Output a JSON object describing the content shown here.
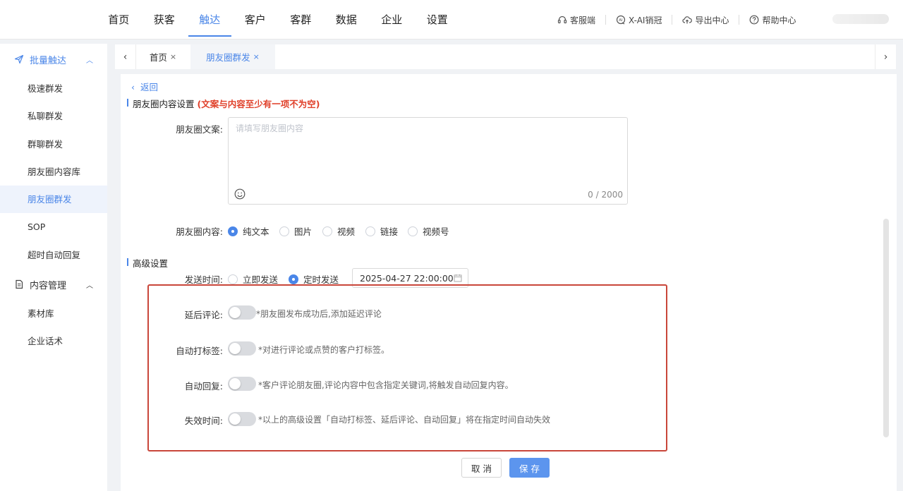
{
  "topnav": {
    "items": [
      "首页",
      "获客",
      "触达",
      "客户",
      "客群",
      "数据",
      "企业",
      "设置"
    ],
    "active_index": 2
  },
  "toptools": {
    "service": "客服端",
    "ai": "X-AI销冠",
    "export": "导出中心",
    "help": "帮助中心"
  },
  "sidebar": {
    "group1": "批量触达",
    "group1_items": [
      "极速群发",
      "私聊群发",
      "群聊群发",
      "朋友圈内容库",
      "朋友圈群发",
      "SOP",
      "超时自动回复"
    ],
    "group1_active_index": 4,
    "group2": "内容管理",
    "group2_items": [
      "素材库",
      "企业话术"
    ]
  },
  "tabs": {
    "tab1": "首页",
    "tab2": "朋友圈群发",
    "close": "×",
    "left_arrow": "‹",
    "right_arrow": "›"
  },
  "page": {
    "back": "返回",
    "section1_title": "朋友圈内容设置",
    "section1_warn": "(文案与内容至少有一项不为空)",
    "copy_label": "朋友圈文案:",
    "copy_placeholder": "请填写朋友圈内容",
    "copy_counter": "0 / 2000",
    "content_label": "朋友圈内容:",
    "content_options": [
      "纯文本",
      "图片",
      "视频",
      "链接",
      "视频号"
    ],
    "content_selected_index": 0,
    "section2_title": "高级设置",
    "send_time_label": "发送时间:",
    "send_options": [
      "立即发送",
      "定时发送"
    ],
    "send_selected_index": 1,
    "send_datetime": "2025-04-27 22:00:00",
    "advanced": [
      {
        "label": "延后评论:",
        "hint": "*朋友圈发布成功后,添加延迟评论",
        "on": false
      },
      {
        "label": "自动打标签:",
        "hint": "*对进行评论或点赞的客户打标签。",
        "on": false
      },
      {
        "label": "自动回复:",
        "hint": "*客户评论朋友圈,评论内容中包含指定关键词,将触发自动回复内容。",
        "on": false
      },
      {
        "label": "失效时间:",
        "hint": "*以上的高级设置「自动打标签、延后评论、自动回复」将在指定时间自动失效",
        "on": false
      }
    ],
    "cancel": "取 消",
    "save": "保 存"
  },
  "colors": {
    "accent": "#4a86e8",
    "warn": "#e0402a",
    "highlight_border": "#c9463a"
  }
}
